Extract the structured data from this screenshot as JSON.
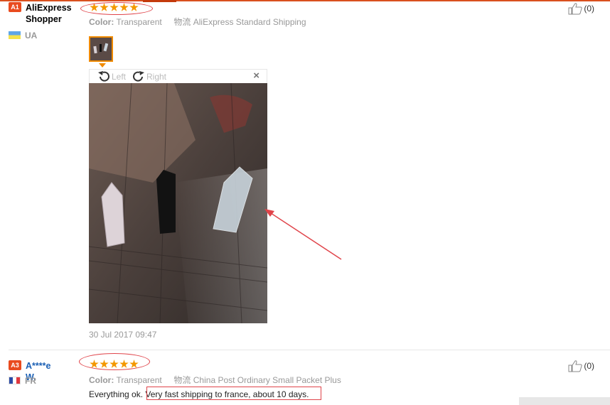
{
  "reviews": [
    {
      "user": {
        "level": "A1",
        "level_color": "#e94b1f",
        "name": "AliExpress\nShopper",
        "name_color": "#000000",
        "country": "UA"
      },
      "stars": 5,
      "attributes": {
        "color_label": "Color:",
        "color_value": "Transparent",
        "shipping_label": "物流",
        "shipping_value": "AliExpress Standard Shipping"
      },
      "helpful": {
        "count": "(0)"
      },
      "viewer": {
        "left_label": "Left",
        "right_label": "Right",
        "close_label": "×"
      },
      "date": "30 Jul 2017 09:47"
    },
    {
      "user": {
        "level": "A3",
        "level_color": "#e94b1f",
        "name": "A****e W.",
        "name_color": "#1a5fb4",
        "country": "FR"
      },
      "stars": 5,
      "attributes": {
        "color_label": "Color:",
        "color_value": "Transparent",
        "shipping_label": "物流",
        "shipping_value": "China Post Ordinary Small Packet Plus"
      },
      "helpful": {
        "count": "(0)"
      },
      "text_plain": "Everything ok. ",
      "text_highlighted": "Very fast shipping to france, about 10 days."
    }
  ],
  "colors": {
    "accent": "#f39800",
    "annotation_red": "#e0444a",
    "top_border": "#d9501e"
  }
}
